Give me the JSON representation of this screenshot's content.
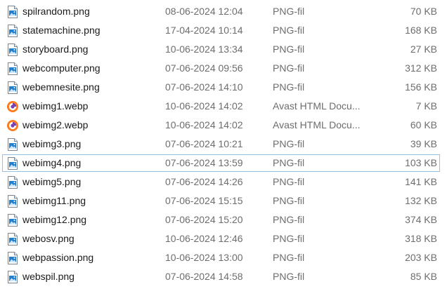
{
  "files": [
    {
      "name": "spilrandom.png",
      "date": "08-06-2024 12:04",
      "type": "PNG-fil",
      "size": "70 KB",
      "icon": "png-file-icon"
    },
    {
      "name": "statemachine.png",
      "date": "17-04-2024 10:14",
      "type": "PNG-fil",
      "size": "168 KB",
      "icon": "png-file-icon"
    },
    {
      "name": "storyboard.png",
      "date": "10-06-2024 13:34",
      "type": "PNG-fil",
      "size": "27 KB",
      "icon": "png-file-icon"
    },
    {
      "name": "webcomputer.png",
      "date": "07-06-2024 09:56",
      "type": "PNG-fil",
      "size": "312 KB",
      "icon": "png-file-icon"
    },
    {
      "name": "webemnesite.png",
      "date": "07-06-2024 14:10",
      "type": "PNG-fil",
      "size": "156 KB",
      "icon": "png-file-icon"
    },
    {
      "name": "webimg1.webp",
      "date": "10-06-2024 14:02",
      "type": "Avast HTML Docu...",
      "size": "7 KB",
      "icon": "avast-browser-icon"
    },
    {
      "name": "webimg2.webp",
      "date": "10-06-2024 14:02",
      "type": "Avast HTML Docu...",
      "size": "60 KB",
      "icon": "avast-browser-icon"
    },
    {
      "name": "webimg3.png",
      "date": "07-06-2024 10:21",
      "type": "PNG-fil",
      "size": "39 KB",
      "icon": "png-file-icon"
    },
    {
      "name": "webimg4.png",
      "date": "07-06-2024 13:59",
      "type": "PNG-fil",
      "size": "103 KB",
      "icon": "png-file-icon",
      "focused": true
    },
    {
      "name": "webimg5.png",
      "date": "07-06-2024 14:26",
      "type": "PNG-fil",
      "size": "141 KB",
      "icon": "png-file-icon"
    },
    {
      "name": "webimg11.png",
      "date": "07-06-2024 15:15",
      "type": "PNG-fil",
      "size": "132 KB",
      "icon": "png-file-icon"
    },
    {
      "name": "webimg12.png",
      "date": "07-06-2024 15:20",
      "type": "PNG-fil",
      "size": "374 KB",
      "icon": "png-file-icon"
    },
    {
      "name": "webosv.png",
      "date": "10-06-2024 12:46",
      "type": "PNG-fil",
      "size": "318 KB",
      "icon": "png-file-icon"
    },
    {
      "name": "webpassion.png",
      "date": "10-06-2024 13:00",
      "type": "PNG-fil",
      "size": "203 KB",
      "icon": "png-file-icon"
    },
    {
      "name": "webspil.png",
      "date": "07-06-2024 14:58",
      "type": "PNG-fil",
      "size": "85 KB",
      "icon": "png-file-icon"
    }
  ],
  "colors": {
    "focus_border": "#99c2e5",
    "secondary_text": "#6d6d6d"
  }
}
